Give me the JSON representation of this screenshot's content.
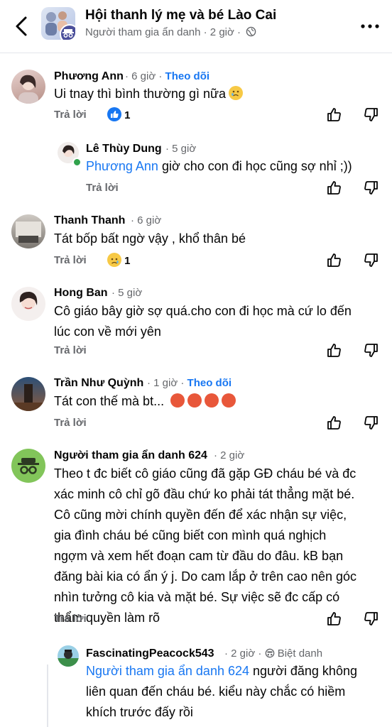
{
  "group": {
    "title": "Hội thanh lý mẹ và bé Lào Cai",
    "subtitle": "Người tham gia ẩn danh · 2 giờ ·"
  },
  "comments": [
    {
      "name": "Phương Ann",
      "time": "· 6 giờ ·",
      "follow": "Theo dõi",
      "text": "Ui tnay thì bình thường gì nữa",
      "reply": "Trả lời",
      "react_count": "1"
    },
    {
      "name": "Lê Thùy Dung",
      "time": "· 5 giờ",
      "mention": "Phương Ann",
      "text": " giờ cho con đi học cũng sợ nhỉ ;))",
      "reply": "Trả lời"
    },
    {
      "name": "Thanh Thanh",
      "time": "· 6 giờ",
      "text": "Tát bốp bất ngờ vậy , khổ thân bé",
      "reply": "Trả lời",
      "react_count": "1"
    },
    {
      "name": "Hong Ban",
      "time": "· 5 giờ",
      "text1": "Cô giáo bây giờ sợ quá.cho con đi học mà cứ lo đến",
      "text2": "lúc con về mới yên",
      "reply": "Trả lời"
    },
    {
      "name": "Trần Như Quỳnh",
      "time": "· 1 giờ ·",
      "follow": "Theo dõi",
      "text": "Tát con thế mà bt...",
      "reply": "Trả lời"
    },
    {
      "name": "Người tham gia ẩn danh 624",
      "time": "· 2 giờ",
      "lines": [
        "Theo t đc biết cô giáo cũng đã gặp GĐ cháu bé và đc",
        "xác minh cô chỉ gõ đầu chứ ko phải tát thẳng mặt bé.",
        "Cô cũng mời chính quyền đến để xác nhận sự việc,",
        "gia đình cháu bé cũng biết con mình quá nghịch",
        "ngợm và xem hết  đoạn cam từ đầu do đâu. kB bạn",
        "đăng bài kia có ẩn ý j. Do cam lắp ở trên cao nên góc",
        "nhìn tưởng cô kia và mặt bé. Sự việc sẽ đc cấp có",
        "thẩm quyền làm rõ"
      ],
      "reply": "Trả lời"
    },
    {
      "name": "FascinatingPeacock543",
      "time": "· 2 giờ ·",
      "badge": "Biệt danh",
      "mention": "Người tham gia ẩn danh 624",
      "line1": " người đăng không",
      "line2": "liên quan đến cháu bé. kiểu này chắc có hiềm",
      "line3": "khích trước đấy rồi"
    }
  ],
  "colors": {
    "link": "#1877f2",
    "muted": "#65676b",
    "text": "#050505"
  }
}
